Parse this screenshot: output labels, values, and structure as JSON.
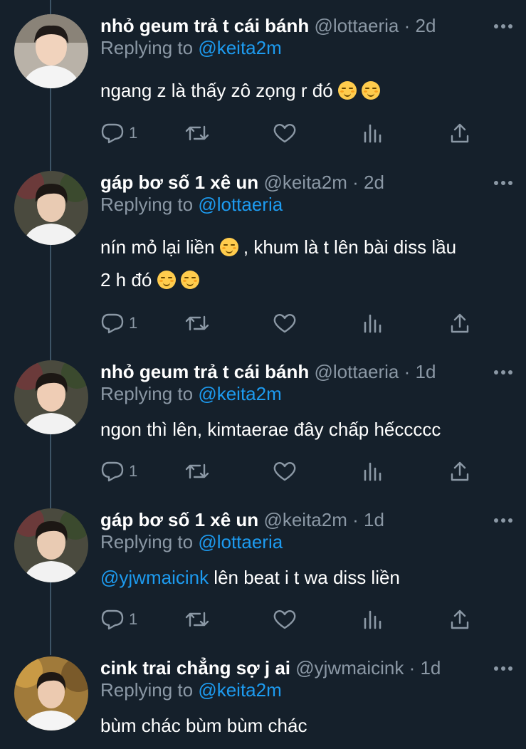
{
  "colors": {
    "background": "#15202b",
    "text": "#ffffff",
    "muted": "#8b98a5",
    "accent": "#1d9bf0"
  },
  "tweets": [
    {
      "name": "nhỏ geum trả t cái bánh",
      "handle": "@lottaeria",
      "time": "2d",
      "replying_label": "Replying to",
      "replying_to": "@keita2m",
      "text_lines": [
        "ngang z là thấy zô zọng r đó"
      ],
      "emoji": [
        "smiling-face",
        "smiling-face"
      ],
      "reply_count": "1"
    },
    {
      "name": "gáp bơ số 1 xê un",
      "handle": "@keita2m",
      "time": "2d",
      "replying_label": "Replying to",
      "replying_to": "@lottaeria",
      "text_line1": "nín mỏ lại liền",
      "text_line1b": ", khum là t lên bài diss lầu",
      "text_line2": "2 h đó",
      "reply_count": "1"
    },
    {
      "name": "nhỏ geum trả t cái bánh",
      "handle": "@lottaeria",
      "time": "1d",
      "replying_label": "Replying to",
      "replying_to": "@keita2m",
      "text": "ngon thì lên, kimtaerae đây chấp hếccccc",
      "reply_count": "1"
    },
    {
      "name": "gáp bơ số 1 xê un",
      "handle": "@keita2m",
      "time": "1d",
      "replying_label": "Replying to",
      "replying_to": "@lottaeria",
      "mention": "@yjwmaicink",
      "text": " lên beat i t wa diss liền",
      "reply_count": "1"
    },
    {
      "name": "cink trai chẳng sợ j ai",
      "handle": "@yjwmaicink",
      "time": "1d",
      "replying_label": "Replying to",
      "replying_to": "@keita2m",
      "text": "bùm chác bùm bùm chác"
    }
  ],
  "time_separator": " · ",
  "icons": [
    "reply-icon",
    "retweet-icon",
    "like-icon",
    "analytics-icon",
    "share-icon",
    "more-icon"
  ]
}
